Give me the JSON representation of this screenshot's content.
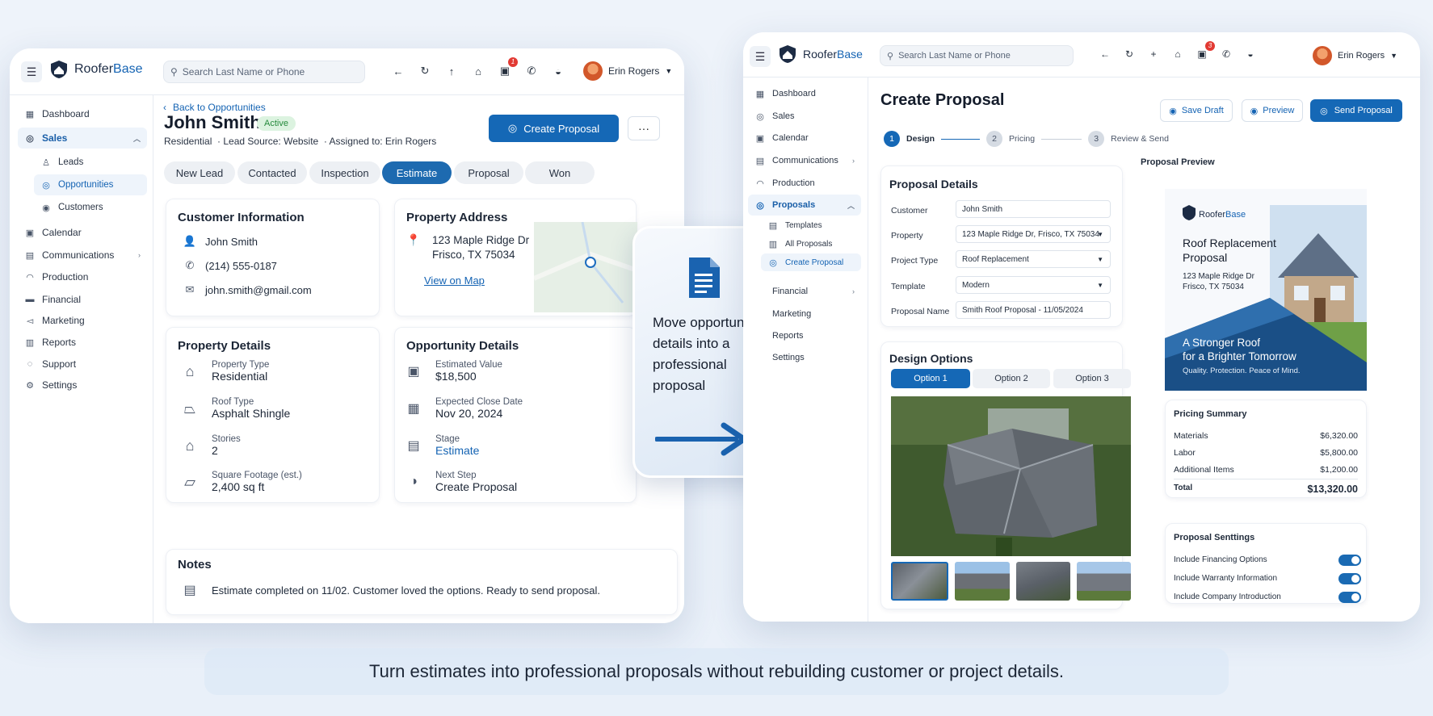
{
  "brand": {
    "name_part1": "Roofer",
    "name_part2": "Base"
  },
  "search": {
    "placeholder": "Search Last Name or Phone"
  },
  "user": {
    "name": "Erin Rogers"
  },
  "notif_count": "1",
  "notif_count_b": "3",
  "left": {
    "sidebar": {
      "dashboard": "Dashboard",
      "sales": "Sales",
      "leads": "Leads",
      "opportunities": "Opportunities",
      "customers": "Customers",
      "calendar": "Calendar",
      "communications": "Communications",
      "production": "Production",
      "financial": "Financial",
      "marketing": "Marketing",
      "reports": "Reports",
      "support": "Support",
      "settings": "Settings"
    },
    "back_link": "Back to Opportunities",
    "name": "John Smith",
    "status": "Active",
    "meta": "Residential  · Lead Source: Website  · Assigned to: Erin Rogers",
    "create_proposal": "Create Proposal",
    "more": "···",
    "stages": [
      "New Lead",
      "Contacted",
      "Inspection",
      "Estimate",
      "Proposal",
      "Won"
    ],
    "customer_info": {
      "title": "Customer Information",
      "name": "John Smith",
      "phone": "(214) 555-0187",
      "email": "john.smith@gmail.com"
    },
    "property_address": {
      "title": "Property Address",
      "line1": "123 Maple Ridge Dr",
      "line2": "Frisco, TX 75034",
      "map_link": "View on Map"
    },
    "property_details": {
      "title": "Property Details",
      "type_label": "Property Type",
      "type_value": "Residential",
      "roof_label": "Roof Type",
      "roof_value": "Asphalt Shingle",
      "stories_label": "Stories",
      "stories_value": "2",
      "sqft_label": "Square Footage (est.)",
      "sqft_value": "2,400 sq ft"
    },
    "opportunity_details": {
      "title": "Opportunity Details",
      "value_label": "Estimated Value",
      "value_value": "$18,500",
      "close_label": "Expected Close Date",
      "close_value": "Nov 20, 2024",
      "stage_label": "Stage",
      "stage_value": "Estimate",
      "next_label": "Next Step",
      "next_value": "Create Proposal"
    },
    "notes": {
      "title": "Notes",
      "text": "Estimate completed on 11/02. Customer loved the options. Ready to send proposal."
    }
  },
  "callout": {
    "text": "Move opportunity details into a professional proposal"
  },
  "right": {
    "sidebar": {
      "dashboard": "Dashboard",
      "sales": "Sales",
      "calendar": "Calendar",
      "communications": "Communications",
      "production": "Production",
      "proposals": "Proposals",
      "templates": "Templates",
      "all_proposals": "All Proposals",
      "create_proposal": "Create Proposal",
      "financial": "Financial",
      "marketing": "Marketing",
      "reports": "Reports",
      "settings": "Settings"
    },
    "title": "Create Proposal",
    "save_draft": "Save Draft",
    "preview": "Preview",
    "send": "Send Proposal",
    "steps": [
      {
        "num": "1",
        "label": "Design"
      },
      {
        "num": "2",
        "label": "Pricing"
      },
      {
        "num": "3",
        "label": "Review & Send"
      }
    ],
    "details": {
      "title": "Proposal Details",
      "customer_label": "Customer",
      "customer_value": "John Smith",
      "property_label": "Property",
      "property_value": "123 Maple Ridge Dr, Frisco, TX 75034",
      "project_label": "Project Type",
      "project_value": "Roof Replacement",
      "template_label": "Template",
      "template_value": "Modern",
      "name_label": "Proposal Name",
      "name_value": "Smith Roof Proposal - 11/05/2024"
    },
    "design": {
      "title": "Design Options",
      "options": [
        "Option 1",
        "Option 2",
        "Option 3"
      ]
    },
    "preview_panel": {
      "title": "Proposal Preview",
      "doc_title": "Roof Replacement Proposal",
      "addr1": "123 Maple Ridge Dr",
      "addr2": "Frisco, TX 75034",
      "tagline1": "A Stronger Roof",
      "tagline2": "for a Brighter Tomorrow",
      "tagline3": "Quality. Protection. Peace of Mind."
    },
    "pricing": {
      "title": "Pricing Summary",
      "rows": [
        {
          "label": "Materials",
          "value": "$6,320.00"
        },
        {
          "label": "Labor",
          "value": "$5,800.00"
        },
        {
          "label": "Additional Items",
          "value": "$1,200.00"
        }
      ],
      "total_label": "Total",
      "total_value": "$13,320.00"
    },
    "settings": {
      "title": "Proposal Senttings",
      "items": [
        "Include Financing Options",
        "Include Warranty Information",
        "Include Company Introduction"
      ],
      "states": [
        true,
        true,
        true
      ]
    }
  },
  "footer": {
    "caption": "Turn estimates into professional proposals without rebuilding customer or project details."
  }
}
